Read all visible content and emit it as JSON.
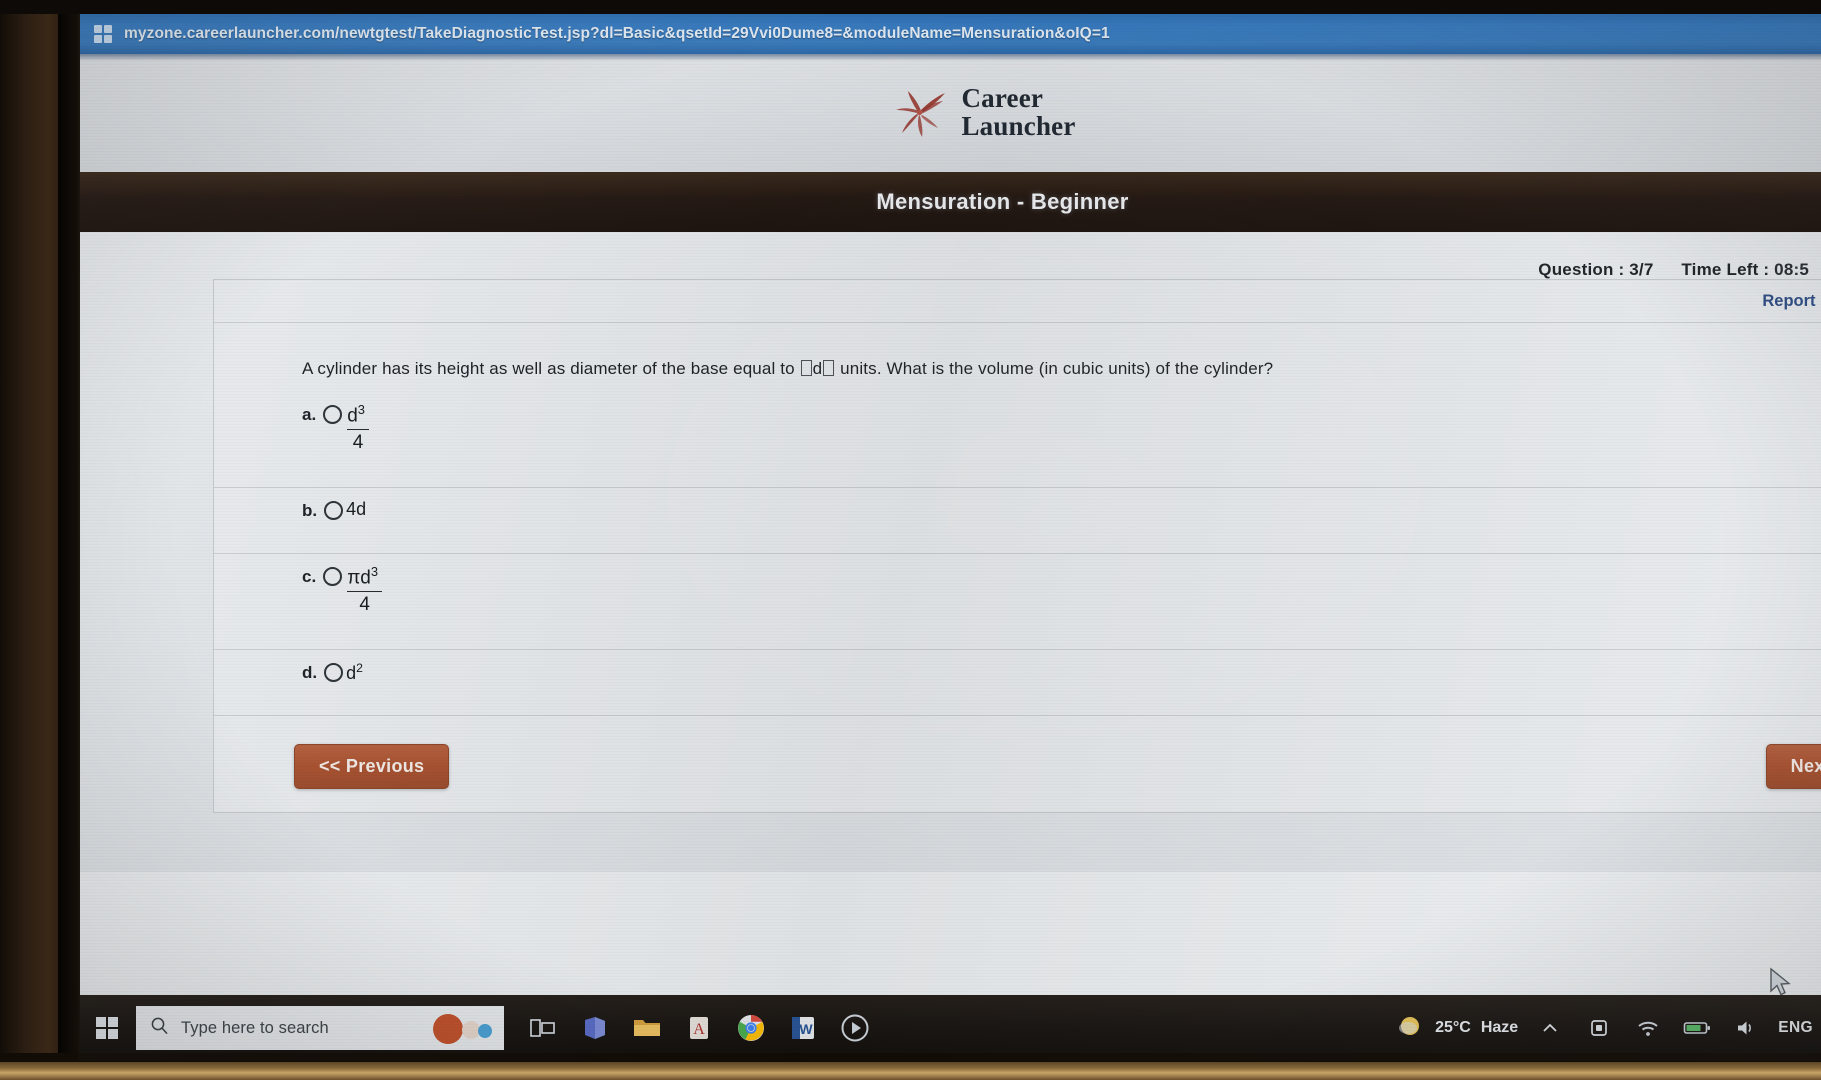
{
  "browser": {
    "url": "myzone.careerlauncher.com/newtgtest/TakeDiagnosticTest.jsp?dl=Basic&qsetId=29Vvi0Dume8=&moduleName=Mensuration&oIQ=1",
    "favicon_name": "site-favicon"
  },
  "site": {
    "logo_line1": "Career",
    "logo_line2": "Launcher",
    "logo_accent": "#9c3b33"
  },
  "test": {
    "title": "Mensuration - Beginner",
    "question_label": "Question :",
    "question_value": "3/7",
    "time_label": "Time Left :",
    "time_value": "08:5",
    "report_error": "Report Err"
  },
  "question": {
    "text_before": "A cylinder has its height as well as diameter of the base equal to ",
    "variable": "d",
    "text_after": " units. What is the volume (in cubic units) of the cylinder?",
    "options": [
      {
        "letter": "a.",
        "kind": "fraction",
        "numerator": "d",
        "numerator_sup": "3",
        "denominator": "4",
        "plain": ""
      },
      {
        "letter": "b.",
        "kind": "plain",
        "numerator": "",
        "numerator_sup": "",
        "denominator": "",
        "plain": "4d"
      },
      {
        "letter": "c.",
        "kind": "fraction",
        "numerator": "πd",
        "numerator_sup": "3",
        "denominator": "4",
        "plain": ""
      },
      {
        "letter": "d.",
        "kind": "plain-sup",
        "numerator": "d",
        "numerator_sup": "2",
        "denominator": "",
        "plain": "d"
      }
    ]
  },
  "nav": {
    "previous_label": "<< Previous",
    "next_label": "Next >",
    "button_color": "#a9512f"
  },
  "taskbar": {
    "start_name": "windows-start-button",
    "search_placeholder": "Type here to search",
    "apps": [
      {
        "name": "task-view-icon",
        "glyph": "☰"
      },
      {
        "name": "microsoft-teams-icon",
        "glyph": "◆"
      },
      {
        "name": "file-explorer-icon",
        "glyph": "▬"
      },
      {
        "name": "adobe-acrobat-icon",
        "glyph": "A"
      },
      {
        "name": "google-chrome-icon",
        "glyph": "◎"
      },
      {
        "name": "microsoft-word-icon",
        "glyph": "W"
      },
      {
        "name": "media-player-icon",
        "glyph": "▶"
      }
    ],
    "temperature": "25°C",
    "weather_condition": "Haze",
    "tray": [
      {
        "name": "show-hidden-icons-chevron",
        "glyph": "⌃"
      },
      {
        "name": "onedrive-icon",
        "glyph": "☁"
      },
      {
        "name": "wifi-icon",
        "glyph": "◠"
      },
      {
        "name": "battery-icon",
        "glyph": "▭"
      },
      {
        "name": "volume-icon",
        "glyph": "🔊"
      }
    ],
    "language": "ENG"
  }
}
